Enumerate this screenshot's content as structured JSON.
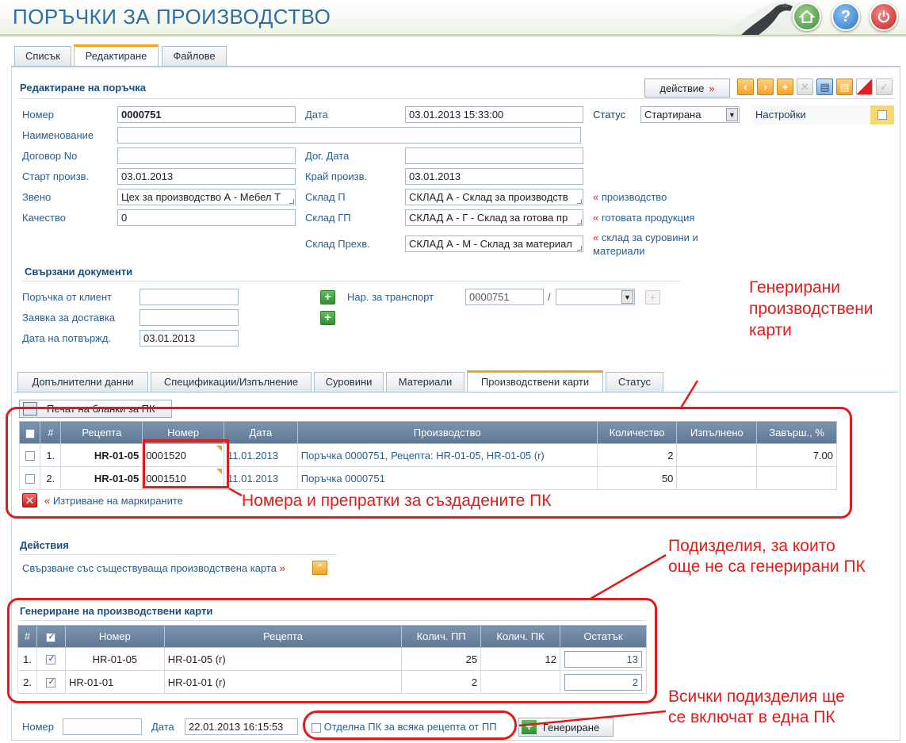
{
  "app": {
    "title": "ПОРЪЧКИ ЗА ПРОИЗВОДСТВО"
  },
  "main_tabs": [
    "Списък",
    "Редактиране",
    "Файлове"
  ],
  "section": {
    "title": "Редактиране на поръчка",
    "action_label": "действие",
    "action_icon": "double-chevron-right-icon"
  },
  "form": {
    "nomer_label": "Номер",
    "nomer_value": "0000751",
    "data_label": "Дата",
    "data_value": "03.01.2013 15:33:00",
    "status_label": "Статус",
    "status_value": "Стартирана",
    "settings_label": "Настройки",
    "naim_label": "Наименование",
    "naim_value": "",
    "dogovor_label": "Договор No",
    "dogovor_value": "",
    "dog_data_label": "Дог. Дата",
    "dog_data_value": "",
    "start_label": "Старт произв.",
    "start_value": "03.01.2013",
    "kraj_label": "Край произв.",
    "kraj_value": "03.01.2013",
    "zveno_label": "Звено",
    "zveno_value": "Цех за производство А - Мебел Т",
    "sklad_p_label": "Склад П",
    "sklad_p_value": "СКЛАД А - Склад за производств",
    "sklad_p_link": "производство",
    "kachestvo_label": "Качество",
    "kachestvo_value": "0",
    "sklad_gp_label": "Склад ГП",
    "sklad_gp_value": "СКЛАД А - Г - Склад за готова пр",
    "sklad_gp_link": "готовата продукция",
    "sklad_prehv_label": "Склад Прехв.",
    "sklad_prehv_value": "СКЛАД А - М - Склад за материал",
    "sklad_prehv_link_1": "склад за суровини и",
    "sklad_prehv_link_2": "материали"
  },
  "related": {
    "title": "Свързани документи",
    "porachka_label": "Поръчка от клиент",
    "porachka_value": "",
    "zayavka_label": "Заявка за доставка",
    "zayavka_value": "",
    "potv_label": "Дата на потвържд.",
    "potv_value": "03.01.2013",
    "transport_label": "Нар. за транспорт",
    "transport_value": "0000751",
    "transport_sep": "/"
  },
  "sub_tabs": [
    "Допълнителни данни",
    "Спецификации/Изпълнение",
    "Суровини",
    "Материали",
    "Производствени карти",
    "Статус"
  ],
  "cards": {
    "print_button": "Печат на бланки за ПК",
    "headers": [
      "#",
      "Рецепта",
      "Номер",
      "Дата",
      "Производство",
      "Количество",
      "Изпълнено",
      "Завърш., %"
    ],
    "rows": [
      {
        "idx": "1.",
        "recipe": "HR-01-05",
        "number": "0001520",
        "date": "11.01.2013",
        "production": "Поръчка 0000751, Рецепта: HR-01-05, HR-01-05 (r)",
        "qty": "2",
        "done": "",
        "pct": "7.00"
      },
      {
        "idx": "2.",
        "recipe": "HR-01-05",
        "number": "0001510",
        "date": "11.01.2013",
        "production": "Поръчка 0000751",
        "qty": "50",
        "done": "",
        "pct": ""
      }
    ],
    "delete_label": "Изтриване на маркираните"
  },
  "actions": {
    "title": "Действия",
    "link_label": "Свързване със съществуваща производствена карта"
  },
  "generate": {
    "title": "Генериране на производствени карти",
    "headers": [
      "#",
      "Номер",
      "Рецепта",
      "Колич. ПП",
      "Колич. ПК",
      "Остатък"
    ],
    "rows": [
      {
        "idx": "1.",
        "number": "HR-01-05",
        "recipe": "HR-01-05 (r)",
        "qty_pp": "25",
        "qty_pk": "12",
        "rest": "13"
      },
      {
        "idx": "2.",
        "number": "HR-01-01",
        "recipe": "HR-01-01 (r)",
        "qty_pp": "2",
        "qty_pk": "",
        "rest": "2"
      }
    ]
  },
  "bottom": {
    "nomer_label": "Номер",
    "nomer_value": "",
    "data_label": "Дата",
    "data_value": "22.01.2013 16:15:53",
    "separate_label": "Отделна ПК за всяка рецепта от ПП",
    "generate_button": "Генериране"
  },
  "annotations": {
    "generated_1": "Генерирани",
    "generated_2": "производствени",
    "generated_3": "карти",
    "numbers": "Номера и препратки за създадените ПК",
    "sub_1": "Подизделия, за които",
    "sub_2": "още не са генерирани ПК",
    "all_1": "Всички подизделия ще",
    "all_2": "се включат в една ПК"
  },
  "colors": {
    "accent": "#f0a420",
    "link": "#2a5d8f",
    "annotation": "#e01b1b",
    "table_header": "#6d86a3"
  }
}
